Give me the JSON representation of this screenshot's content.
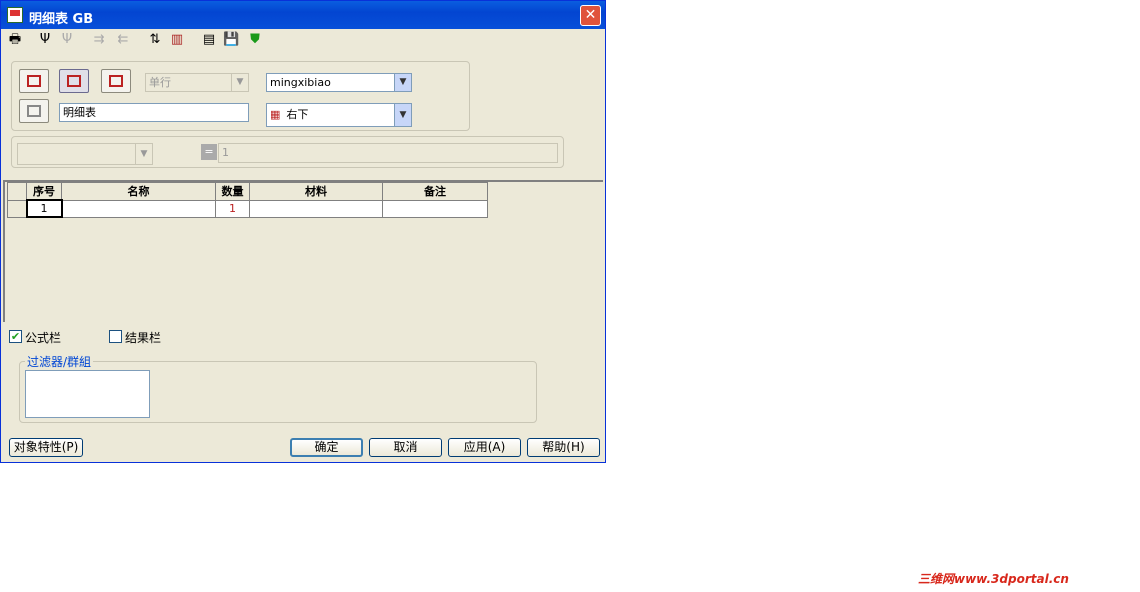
{
  "window": {
    "title": "明细表 GB"
  },
  "toolbar": {
    "icons": [
      "printer-icon",
      "insert-row-icon",
      "delete-row-icon",
      "merge-icon",
      "split-icon",
      "sort-icon",
      "edit-icon",
      "template-icon",
      "save-icon",
      "shield-icon"
    ]
  },
  "top_panel": {
    "row_mode_select": "单行",
    "style_select": "mingxibiao",
    "name_input": "明细表",
    "direction_select": "右下"
  },
  "formula_bar": {
    "field_select": "",
    "eq_label": "=",
    "formula_input": "1"
  },
  "table": {
    "columns": [
      "序号",
      "名称",
      "数量",
      "材料",
      "备注"
    ],
    "rows": [
      [
        "1",
        "",
        "1",
        "",
        ""
      ]
    ]
  },
  "options": {
    "formula_bar_label": "公式栏",
    "formula_bar_checked": true,
    "result_bar_label": "结果栏",
    "result_bar_checked": false
  },
  "filter_group": {
    "title": "过滤器/群組"
  },
  "buttons": {
    "properties": "对象特性(P)",
    "ok": "确定",
    "cancel": "取消",
    "apply": "应用(A)",
    "help": "帮助(H)"
  },
  "watermark": "三维网www.3dportal.cn"
}
